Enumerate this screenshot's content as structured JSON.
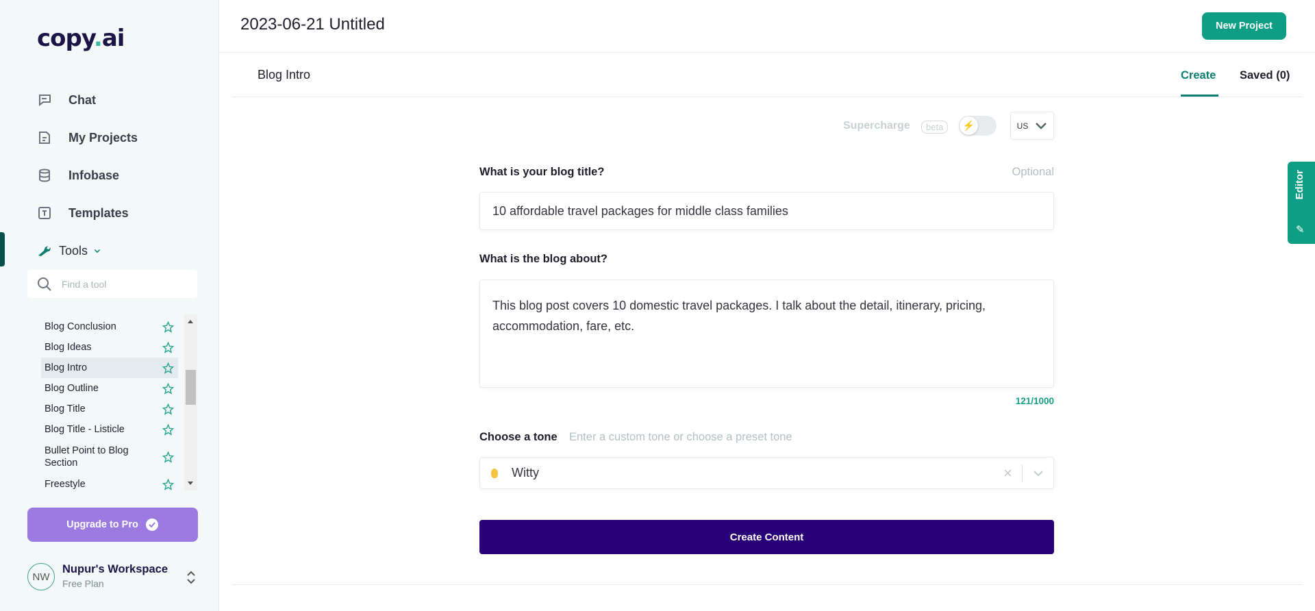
{
  "brand": {
    "logo_a": "copy",
    "logo_dot": ".",
    "logo_b": "ai"
  },
  "sidebar": {
    "nav": [
      {
        "label": "Chat",
        "icon": "chat-icon"
      },
      {
        "label": "My Projects",
        "icon": "document-icon"
      },
      {
        "label": "Infobase",
        "icon": "database-icon"
      },
      {
        "label": "Templates",
        "icon": "template-icon"
      }
    ],
    "tools_label": "Tools",
    "search_placeholder": "Find a tool",
    "tools": [
      "Blog Conclusion",
      "Blog Ideas",
      "Blog Intro",
      "Blog Outline",
      "Blog Title",
      "Blog Title - Listicle",
      "Bullet Point to Blog Section",
      "Freestyle"
    ],
    "selected_tool": "Blog Intro",
    "upgrade_label": "Upgrade to Pro",
    "workspace": {
      "initials": "NW",
      "name": "Nupur's Workspace",
      "plan": "Free Plan"
    }
  },
  "header": {
    "title": "2023-06-21 Untitled",
    "new_project": "New Project"
  },
  "tabs": {
    "tool_name": "Blog Intro",
    "create": "Create",
    "saved": "Saved (0)",
    "active": "Create"
  },
  "options": {
    "supercharge": "Supercharge",
    "beta": "beta",
    "supercharge_on": false,
    "language": "US"
  },
  "form": {
    "title_label": "What is your blog title?",
    "optional": "Optional",
    "title_value": "10 affordable travel packages for middle class families",
    "about_label": "What is the blog about?",
    "about_value": "This blog post covers 10 domestic travel packages. I talk about the detail, itinerary, pricing, accommodation, fare, etc.",
    "counter": "121/1000",
    "tone_label": "Choose a tone",
    "tone_hint": "Enter a custom tone or choose a preset tone",
    "tone_value": "Witty",
    "submit": "Create Content"
  },
  "editor_tab": "Editor",
  "colors": {
    "accent": "#0e9e86",
    "primary": "#2a0077",
    "upgrade": "#9b7be0",
    "sidebar_bg": "#f3f8f9"
  }
}
